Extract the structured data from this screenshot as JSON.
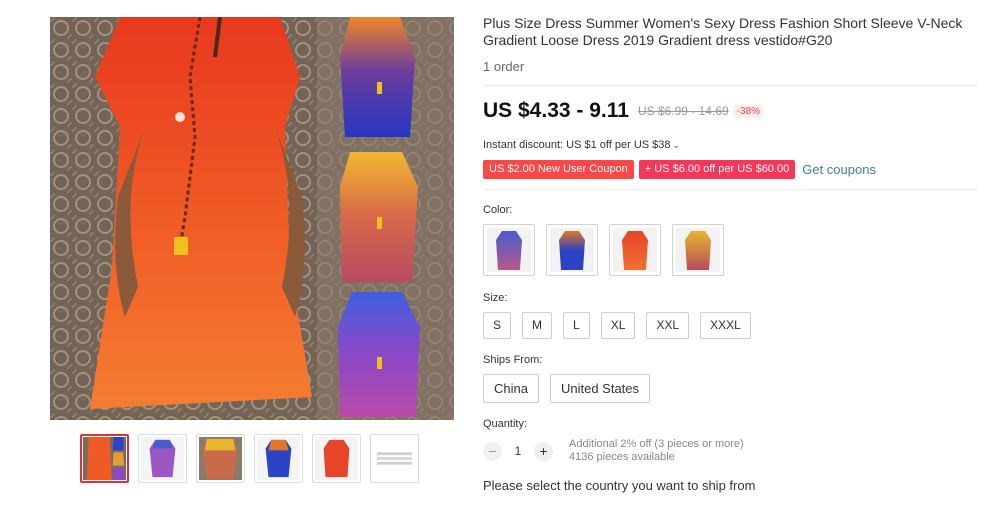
{
  "product": {
    "title": "Plus Size Dress Summer Women's Sexy Dress Fashion Short Sleeve V-Neck Gradient Loose Dress 2019 Gradient dress vestido#G20",
    "orders": "1 order"
  },
  "price": {
    "current": "US $4.33 - 9.11",
    "original": "US $6.99 - 14.69",
    "discount": "-38%"
  },
  "promo": {
    "instant_discount": "Instant discount: US $1 off per US $38",
    "coupons": [
      "US $2.00 New User Coupon",
      "+ US $6.00 off per US $60.00"
    ],
    "get_coupons": "Get coupons"
  },
  "color": {
    "label": "Color:",
    "options": [
      {
        "name": "purple-gradient",
        "top": "#4a5bd0",
        "bottom": "#b65a86"
      },
      {
        "name": "blue-orange",
        "top": "#e1772a",
        "bottom": "#2b43c4"
      },
      {
        "name": "orange-red",
        "top": "#e6452a",
        "bottom": "#f0712e"
      },
      {
        "name": "yellow-red",
        "top": "#e8b530",
        "bottom": "#b44e5a"
      }
    ]
  },
  "size": {
    "label": "Size:",
    "options": [
      "S",
      "M",
      "L",
      "XL",
      "XXL",
      "XXXL"
    ]
  },
  "ships_from": {
    "label": "Ships From:",
    "options": [
      "China",
      "United States"
    ]
  },
  "quantity": {
    "label": "Quantity:",
    "minus": "−",
    "plus": "+",
    "value": "1",
    "note_line1": "Additional 2% off (3 pieces or more)",
    "note_line2": "4136 pieces available"
  },
  "ship_notice": "Please select the country you want to ship from",
  "colors": {
    "price": "#111111",
    "coupon_red": "#ff4747",
    "coupon_pink": "#f8365a",
    "link": "#3d7ea6",
    "active_thumb_border": "#e2303a"
  }
}
